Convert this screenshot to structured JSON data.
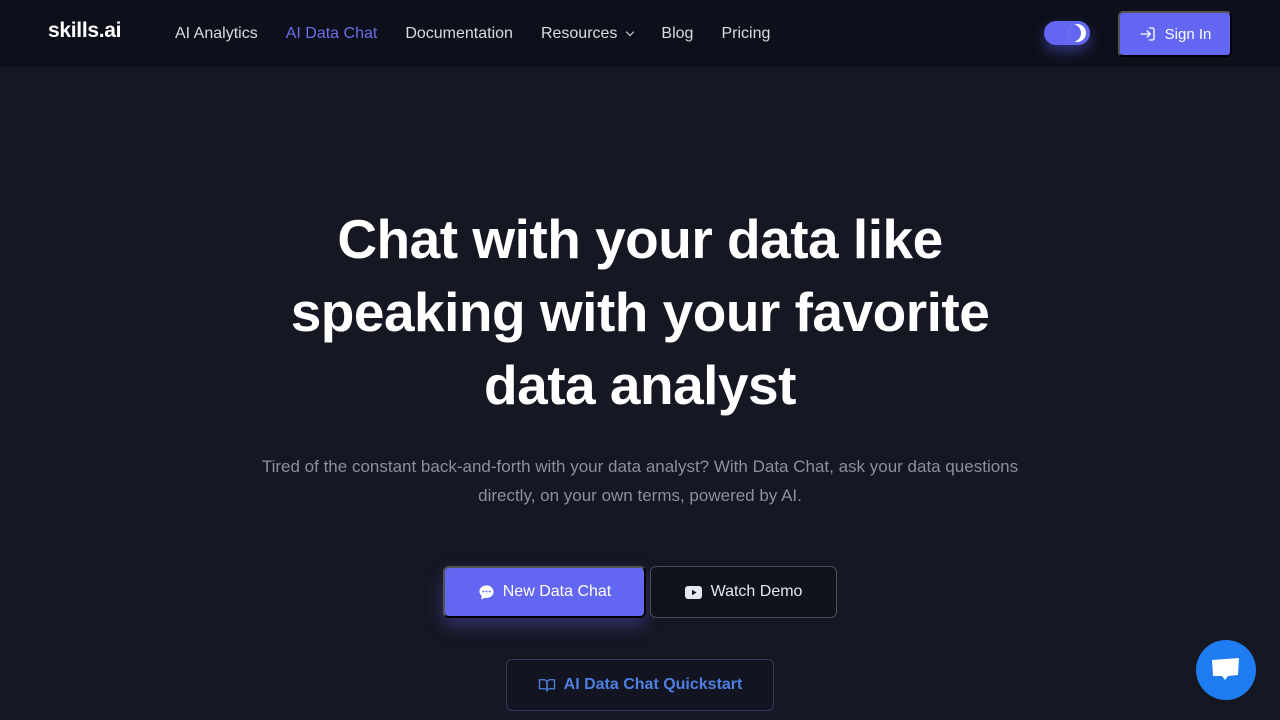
{
  "navbar": {
    "logo": "skills.ai",
    "items": [
      {
        "label": "AI Analytics",
        "active": false
      },
      {
        "label": "AI Data Chat",
        "active": true
      },
      {
        "label": "Documentation",
        "active": false
      },
      {
        "label": "Resources",
        "active": false,
        "has_dropdown": true
      },
      {
        "label": "Blog",
        "active": false
      },
      {
        "label": "Pricing",
        "active": false
      }
    ],
    "theme_toggle": {
      "icon": "moon-icon",
      "state": "dark"
    },
    "sign_in_label": "Sign In",
    "sign_in_icon": "sign-in-icon"
  },
  "hero": {
    "title_lines": [
      "Chat with your data like",
      "speaking with your favorite",
      "data analyst"
    ],
    "subtitle": "Tired of the constant back-and-forth with your data analyst? With Data Chat, ask your data questions directly, on your own terms, powered by AI.",
    "primary_button": {
      "label": "New Data Chat",
      "icon": "chat-bubble-icon"
    },
    "secondary_button": {
      "label": "Watch Demo",
      "icon": "youtube-icon"
    },
    "quickstart_button": {
      "label": "AI Data Chat Quickstart",
      "icon": "book-icon"
    }
  },
  "chat_widget": {
    "icon": "chat-icon"
  },
  "colors": {
    "accent": "#6366f1",
    "active_nav": "#6b6ee8",
    "link_blue": "#4f7fe0",
    "chat_fab": "#1f7bf0",
    "background": "#151722",
    "navbar_bg": "#0d0f1a"
  }
}
